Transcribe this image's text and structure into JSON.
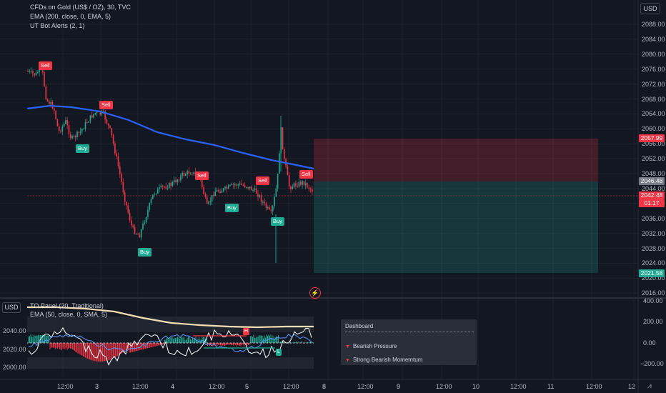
{
  "main_legend": {
    "symbol": "CFDs on Gold (US$ / OZ), 30, TVC",
    "ema": "EMA (200, close, 0, EMA, 5)",
    "ut_bot": "UT Bot Alerts (2, 1)"
  },
  "sub_legend": {
    "panel": "TO Panel (20, Traditional)",
    "ema": "EMA (50, close, 0, SMA, 5)"
  },
  "currency_right": "USD",
  "currency_left": "USD",
  "price_axis": [
    "2088.00",
    "2084.00",
    "2080.00",
    "2076.00",
    "2072.00",
    "2068.00",
    "2064.00",
    "2060.00",
    "2056.00",
    "2052.00",
    "2048.00",
    "2044.00",
    "2040.00",
    "2036.00",
    "2032.00",
    "2028.00",
    "2024.00",
    "2020.00",
    "2016.00"
  ],
  "price_tags": {
    "top": "2057.99",
    "current_gray": "2046.48",
    "current_red": "2042.48",
    "countdown": "01:17",
    "bottom": "2021.58"
  },
  "sub_axis_right": [
    "400.00",
    "200.00",
    "0.00",
    "−200.00"
  ],
  "sub_axis_left": [
    "2040.00",
    "2020.00",
    "2000.00"
  ],
  "signals": {
    "sell": "Sell",
    "buy": "Buy"
  },
  "sub_markers": {
    "h": "H",
    "l": "L"
  },
  "dashboard": {
    "title": "Dashboard",
    "rows": [
      "Bearish Pressure",
      "Strong Bearish Momemtum"
    ]
  },
  "time_axis": [
    "12:00",
    "3",
    "12:00",
    "4",
    "12:00",
    "5",
    "12:00",
    "8",
    "12:00",
    "9",
    "12:00",
    "10",
    "12:00",
    "11",
    "12:00",
    "12"
  ],
  "colors": {
    "background": "#131722",
    "ema200": "#2962ff",
    "up": "#22ab94",
    "down": "#f23645",
    "sell_zone": "#f23645",
    "buy_zone": "#22ab94"
  },
  "icons": {
    "flash": "lightning-icon",
    "tv_logo": "tradingview-logo-icon"
  }
}
